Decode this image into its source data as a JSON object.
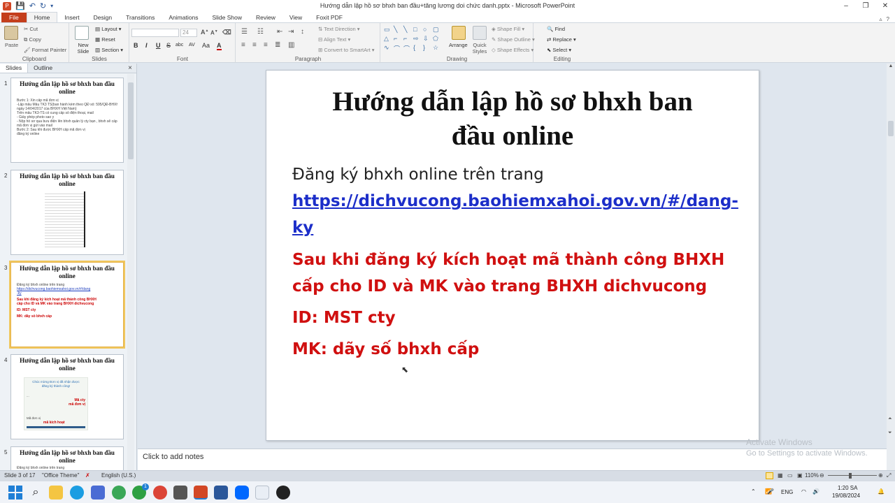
{
  "window": {
    "title": "Hướng dẫn lập hồ sơ bhxh ban đầu+tăng lương doi chức danh.pptx  -  Microsoft PowerPoint",
    "minimize": "–",
    "maximize": "❐",
    "close": "✕"
  },
  "tabs": [
    "File",
    "Home",
    "Insert",
    "Design",
    "Transitions",
    "Animations",
    "Slide Show",
    "Review",
    "View",
    "Foxit PDF"
  ],
  "ribbon": {
    "clipboard": {
      "label": "Clipboard",
      "paste": "Paste",
      "cut": "Cut",
      "copy": "Copy",
      "format_painter": "Format Painter"
    },
    "slides": {
      "label": "Slides",
      "new_slide": "New Slide",
      "layout": "Layout",
      "reset": "Reset",
      "section": "Section"
    },
    "font": {
      "label": "Font",
      "size": "24",
      "bold": "B",
      "italic": "I",
      "underline": "U",
      "strike": "S",
      "shadow": "abc",
      "spacing": "AV",
      "case": "Aa",
      "color": "A"
    },
    "paragraph": {
      "label": "Paragraph",
      "text_direction": "Text Direction",
      "align_text": "Align Text",
      "smartart": "Convert to SmartArt"
    },
    "drawing": {
      "label": "Drawing",
      "arrange": "Arrange",
      "quick_styles": "Quick Styles",
      "shape_fill": "Shape Fill",
      "shape_outline": "Shape Outline",
      "shape_effects": "Shape Effects"
    },
    "editing": {
      "label": "Editing",
      "find": "Find",
      "replace": "Replace",
      "select": "Select"
    }
  },
  "panel": {
    "tab_slides": "Slides",
    "tab_outline": "Outline",
    "close": "×",
    "thumbs": [
      {
        "num": "1",
        "title": "Hướng dẫn lập hồ sơ bhxh ban đầu online",
        "lines": [
          "Bước 1: Xin cấp mã đơn vị",
          "-Lập mẫu Mẫu TK3 TS(ban hành kèm theo QĐ số: 595/QĐ-BHXH",
          "ngày 14/04/2017 của BHXH Việt Nam)",
          "Trên mẫu TK3-TS có cung cấp số điện thoại, mail",
          "- Giấy phép photo sao y",
          "- Nộp hồ sơ qua bưu điện lên bhxh quản lý cty bạn , bhxh sẽ cấp",
          "mã đơn vị gửi vào mail",
          "Bước 2: Sau khi được BHXH cấp mã đơn vị",
          "đăng ký online"
        ]
      },
      {
        "num": "2",
        "title": "Hướng dẫn lập hồ sơ bhxh ban đầu online",
        "lines": []
      },
      {
        "num": "3",
        "title": "Hướng dẫn lập hồ sơ bhxh ban đầu online",
        "lines": [
          "Đăng ký bhxh online trên trang",
          "https://dichvucong.baohiemxahoi.gov.vn/#/dang",
          "-ky",
          "Sau khi đăng ký kích hoạt mã thành công BHXH",
          "cấp cho ID và MK vào trang BHXH dichvucong",
          "ID: MST cty",
          "MK: dãy số bhxh cấp"
        ]
      },
      {
        "num": "4",
        "title": "Hướng dẫn lập hồ sơ bhxh ban đầu online",
        "lines": [
          "Chúc mừng Đơn vị đã nhận được",
          "đăng ký thành công!",
          "...",
          "Mã cty",
          "mã đơn vị",
          "Mã đơn vị",
          "mã kích hoạt"
        ]
      },
      {
        "num": "5",
        "title": "Hướng dẫn lập hồ sơ bhxh ban đầu online",
        "lines": [
          "Đăng ký bhxh online trên trang"
        ]
      }
    ]
  },
  "slide": {
    "title_line1": "Hướng dẫn lập hồ sơ bhxh ban",
    "title_line2": "đầu online",
    "line1": "Đăng ký bhxh online trên trang",
    "link": "https://dichvucong.baohiemxahoi.gov.vn/#/dang-ky",
    "line3a": "Sau khi đăng ký kích hoạt mã thành công BHXH",
    "line3b": "cấp cho ID và MK vào trang BHXH dichvucong",
    "line4": "ID: MST cty",
    "line5": "MK: dãy số bhxh cấp"
  },
  "notes_placeholder": "Click to add notes",
  "watermark": {
    "line1": "Activate Windows",
    "line2": "Go to Settings to activate Windows."
  },
  "status": {
    "slide_count": "Slide 3 of 17",
    "theme": "\"Office Theme\"",
    "language": "English (U.S.)",
    "zoom": "110%"
  },
  "taskbar": {
    "lang": "ENG",
    "time": "1:20 SA",
    "date": "19/08/2024",
    "badge": "1"
  },
  "colors": {
    "file_tab": "#c43e1c",
    "link": "#1c2ec9",
    "red_text": "#d01010",
    "selection": "#f0c75e"
  }
}
